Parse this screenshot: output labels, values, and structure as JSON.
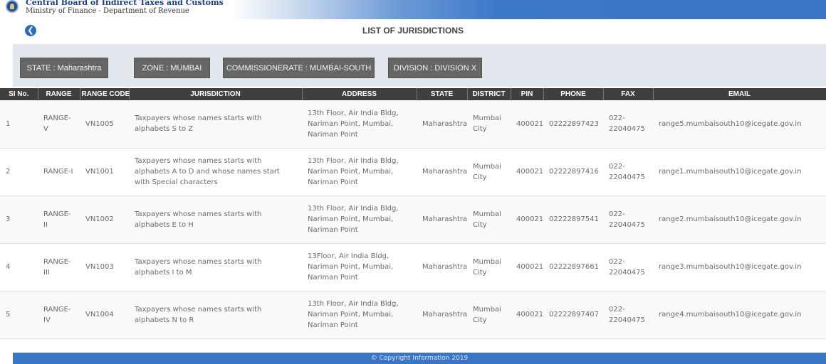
{
  "header": {
    "org_name": "Central Board of Indirect Taxes and Customs",
    "org_sub": "Ministry of Finance - Department of Revenue"
  },
  "page": {
    "back_icon": "chevron-left-icon",
    "title": "LIST OF JURISDICTIONS"
  },
  "filters": {
    "state": "STATE : Maharashtra",
    "zone": "ZONE : MUMBAI",
    "commissionerate": "COMMISSIONERATE : MUMBAI-SOUTH",
    "division": "DIVISION : DIVISION X"
  },
  "table": {
    "columns": [
      "SI No.",
      "RANGE",
      "RANGE CODE",
      "JURISDICTION",
      "ADDRESS",
      "STATE",
      "DISTRICT",
      "PIN",
      "PHONE",
      "FAX",
      "EMAIL"
    ],
    "rows": [
      {
        "sl": "1",
        "range": "RANGE-V",
        "code": "VN1005",
        "jurisdiction": "Taxpayers whose names starts with alphabets S to Z",
        "address": "13th Floor, Air India Bldg, Nariman Point, Mumbai, Nariman Point",
        "state": "Maharashtra",
        "district": "Mumbai City",
        "pin": "400021",
        "phone": "02222897423",
        "fax": "022-22040475",
        "email": "range5.mumbaisouth10@icegate.gov.in"
      },
      {
        "sl": "2",
        "range": "RANGE-I",
        "code": "VN1001",
        "jurisdiction": "Taxpayers whose names starts with alphabets A to D and whose names start with Special characters",
        "address": "13th Floor, Air India Bldg, Nariman Point, Mumbai, Nariman Point",
        "state": "Maharashtra",
        "district": "Mumbai City",
        "pin": "400021",
        "phone": "02222897416",
        "fax": "022-22040475",
        "email": "range1.mumbaisouth10@icegate.gov.in"
      },
      {
        "sl": "3",
        "range": "RANGE-II",
        "code": "VN1002",
        "jurisdiction": "Taxpayers whose names starts with alphabets E to H",
        "address": "13th Floor, Air India Bldg, Nariman Point, Mumbai, Nariman Point",
        "state": "Maharashtra",
        "district": "Mumbai City",
        "pin": "400021",
        "phone": "02222897541",
        "fax": "022-22040475",
        "email": "range2.mumbaisouth10@icegate.gov.in"
      },
      {
        "sl": "4",
        "range": "RANGE-III",
        "code": "VN1003",
        "jurisdiction": "Taxpayers whose names starts with alphabets I to M",
        "address": "13Floor, Air India Bldg, Nariman Point, Mumbai, Nariman Point",
        "state": "Maharashtra",
        "district": "Mumbai City",
        "pin": "400021",
        "phone": "02222897661",
        "fax": "022-22040475",
        "email": "range3.mumbaisouth10@icegate.gov.in"
      },
      {
        "sl": "5",
        "range": "RANGE-IV",
        "code": "VN1004",
        "jurisdiction": "Taxpayers whose names starts with alphabets N to R",
        "address": "13th Floor, Air India Bldg, Nariman Point, Mumbai, Nariman Point",
        "state": "Maharashtra",
        "district": "Mumbai City",
        "pin": "400021",
        "phone": "02222897407",
        "fax": "022-22040475",
        "email": "range4.mumbaisouth10@icegate.gov.in"
      }
    ]
  },
  "footer": {
    "text": "© Copyright Information 2019"
  }
}
